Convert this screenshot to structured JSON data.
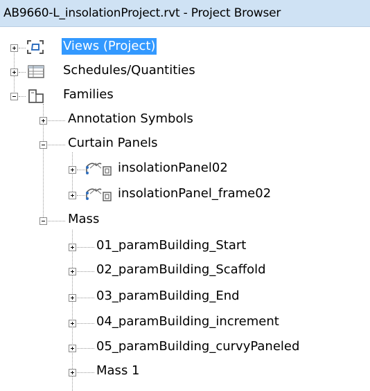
{
  "window": {
    "title": "AB9660-L_insolationProject.rvt - Project Browser"
  },
  "tree": {
    "views": {
      "label": "Views (Project)",
      "icon": "views-icon"
    },
    "schedules": {
      "label": "Schedules/Quantities",
      "icon": "schedule-table-icon"
    },
    "families": {
      "label": "Families",
      "icon": "families-icon",
      "annotation_symbols": {
        "label": "Annotation Symbols"
      },
      "curtain_panels": {
        "label": "Curtain Panels",
        "items": [
          {
            "label": "insolationPanel02",
            "icon": "curtain-panel-family-icon"
          },
          {
            "label": "insolationPanel_frame02",
            "icon": "curtain-panel-family-icon"
          }
        ]
      },
      "mass": {
        "label": "Mass",
        "items": [
          {
            "label": "01_paramBuilding_Start"
          },
          {
            "label": "02_paramBuilding_Scaffold"
          },
          {
            "label": "03_paramBuilding_End"
          },
          {
            "label": "04_paramBuilding_increment"
          },
          {
            "label": "05_paramBuilding_curvyPaneled"
          },
          {
            "label": "Mass 1"
          }
        ]
      }
    }
  },
  "colors": {
    "title_bar": "#cfe2f4",
    "selection": "#3399ff"
  }
}
